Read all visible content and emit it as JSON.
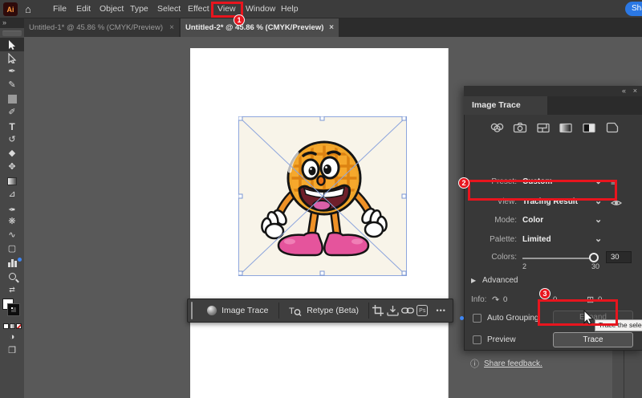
{
  "colors": {
    "annotation_red": "#e8151e",
    "share_blue": "#2b78e4",
    "selection_blue": "#8ea6dd",
    "new_feature_blue": "#3f87f5",
    "artboard_white": "#ffffff",
    "pasteboard_gray": "#595959"
  },
  "menu_bar": {
    "app_logo": "Ai",
    "items": [
      "File",
      "Edit",
      "Object",
      "Type",
      "Select",
      "Effect",
      "View",
      "Window",
      "Help"
    ],
    "share_button_label": "Sha"
  },
  "tab_bar": {
    "overflow_icon": "»",
    "tabs": [
      {
        "label": "Untitled-1* @ 45.86 % (CMYK/Preview)",
        "close_icon": "×"
      },
      {
        "label": "Untitled-2* @ 45.86 % (CMYK/Preview)",
        "close_icon": "×"
      }
    ]
  },
  "quick_actions_bar": {
    "image_trace_label": "Image Trace",
    "retype_label": "Retype (Beta)",
    "ps_label": "Ps",
    "more_icon": "•••"
  },
  "image_trace_panel": {
    "collapse_icon": "«",
    "close_icon": "×",
    "title": "Image Trace",
    "preset_label": "Preset:",
    "preset_value": "Custom",
    "view_label": "View:",
    "view_value": "Tracing Result",
    "mode_label": "Mode:",
    "mode_value": "Color",
    "palette_label": "Palette:",
    "palette_value": "Limited",
    "colors_label": "Colors:",
    "colors_value": "30",
    "colors_min": "2",
    "colors_max": "30",
    "advanced_label": "Advanced",
    "info_label": "Info:",
    "info_paths_count": "0",
    "info_anchors_count": "0",
    "info_colors_count": "0",
    "auto_grouping_label": "Auto Grouping",
    "expand_button_label": "Expand",
    "preview_label": "Preview",
    "trace_button_label": "Trace",
    "share_feedback_label": "Share feedback.",
    "tooltip_text": "Trace the selected"
  },
  "annotations": {
    "badge_1": "1",
    "badge_2": "2",
    "badge_3": "3"
  },
  "icons": {
    "home": "⌂",
    "chevron_down": "⌄",
    "menu_list": "≡",
    "advanced_arrow": "▶",
    "info_paths": "↷",
    "info_anchors": "⌐",
    "info_colors": "⊞",
    "info_circle": "ⓘ",
    "pen": "✒",
    "curvature": "✎",
    "brush": "✐",
    "type": "T",
    "rotate": "↺",
    "eraser": "◆",
    "scale": "✥",
    "measure": "⊿",
    "blend": "❋",
    "width": "∿",
    "artboard": "▢",
    "swap": "⇄",
    "drawing_mode": "◑",
    "screen_mode": "❐"
  }
}
